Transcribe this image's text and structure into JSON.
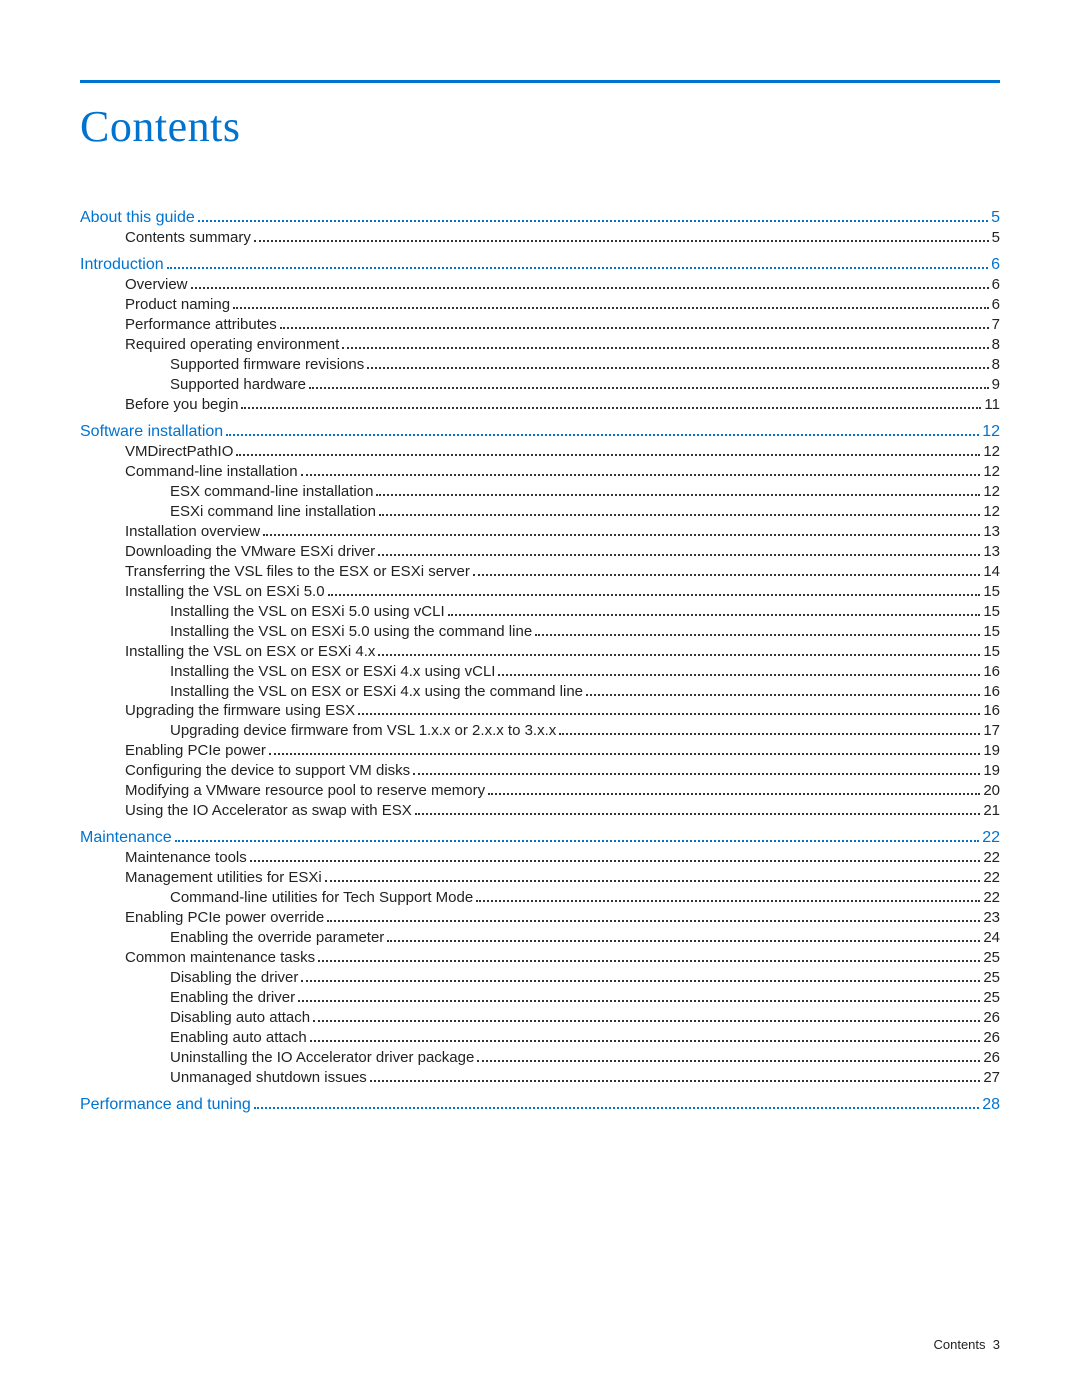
{
  "title": "Contents",
  "footer_label": "Contents",
  "footer_page": "3",
  "entries": [
    {
      "level": 0,
      "label": "About this guide",
      "page": "5"
    },
    {
      "level": 1,
      "label": "Contents summary",
      "page": "5"
    },
    {
      "gap": true
    },
    {
      "level": 0,
      "label": "Introduction",
      "page": "6"
    },
    {
      "level": 1,
      "label": "Overview",
      "page": "6"
    },
    {
      "level": 1,
      "label": "Product naming",
      "page": "6"
    },
    {
      "level": 1,
      "label": "Performance attributes",
      "page": "7"
    },
    {
      "level": 1,
      "label": "Required operating environment",
      "page": "8"
    },
    {
      "level": 2,
      "label": "Supported firmware revisions",
      "page": "8"
    },
    {
      "level": 2,
      "label": "Supported hardware",
      "page": "9"
    },
    {
      "level": 1,
      "label": "Before you begin",
      "page": "11"
    },
    {
      "gap": true
    },
    {
      "level": 0,
      "label": "Software installation",
      "page": "12"
    },
    {
      "level": 1,
      "label": "VMDirectPathIO",
      "page": "12"
    },
    {
      "level": 1,
      "label": "Command-line installation",
      "page": "12"
    },
    {
      "level": 2,
      "label": "ESX command-line installation",
      "page": "12"
    },
    {
      "level": 2,
      "label": "ESXi command line installation",
      "page": "12"
    },
    {
      "level": 1,
      "label": "Installation overview",
      "page": "13"
    },
    {
      "level": 1,
      "label": "Downloading the VMware ESXi driver",
      "page": "13"
    },
    {
      "level": 1,
      "label": "Transferring the VSL files to the ESX or ESXi server",
      "page": "14"
    },
    {
      "level": 1,
      "label": "Installing the VSL on ESXi 5.0",
      "page": "15"
    },
    {
      "level": 2,
      "label": "Installing the VSL on ESXi 5.0 using vCLI",
      "page": "15"
    },
    {
      "level": 2,
      "label": "Installing the VSL on ESXi 5.0 using the command line",
      "page": "15"
    },
    {
      "level": 1,
      "label": "Installing the VSL on ESX or ESXi 4.x",
      "page": "15"
    },
    {
      "level": 2,
      "label": "Installing the VSL on ESX or ESXi 4.x using vCLI",
      "page": "16"
    },
    {
      "level": 2,
      "label": "Installing the VSL on ESX or ESXi 4.x using the command line",
      "page": "16"
    },
    {
      "level": 1,
      "label": "Upgrading the firmware using ESX",
      "page": "16"
    },
    {
      "level": 2,
      "label": "Upgrading device firmware from VSL 1.x.x or 2.x.x to 3.x.x",
      "page": "17"
    },
    {
      "level": 1,
      "label": "Enabling PCIe power",
      "page": "19"
    },
    {
      "level": 1,
      "label": "Configuring the device to support VM disks",
      "page": "19"
    },
    {
      "level": 1,
      "label": "Modifying a VMware resource pool to reserve memory",
      "page": "20"
    },
    {
      "level": 1,
      "label": "Using the IO Accelerator as swap with ESX",
      "page": "21"
    },
    {
      "gap": true
    },
    {
      "level": 0,
      "label": "Maintenance",
      "page": "22"
    },
    {
      "level": 1,
      "label": "Maintenance tools",
      "page": "22"
    },
    {
      "level": 1,
      "label": "Management utilities for ESXi",
      "page": "22"
    },
    {
      "level": 2,
      "label": "Command-line utilities for Tech Support Mode",
      "page": "22"
    },
    {
      "level": 1,
      "label": "Enabling PCIe power override",
      "page": "23"
    },
    {
      "level": 2,
      "label": "Enabling the override parameter",
      "page": "24"
    },
    {
      "level": 1,
      "label": "Common maintenance tasks",
      "page": "25"
    },
    {
      "level": 2,
      "label": "Disabling the driver",
      "page": "25"
    },
    {
      "level": 2,
      "label": "Enabling the driver",
      "page": "25"
    },
    {
      "level": 2,
      "label": "Disabling auto attach",
      "page": "26"
    },
    {
      "level": 2,
      "label": "Enabling auto attach",
      "page": "26"
    },
    {
      "level": 2,
      "label": "Uninstalling the IO Accelerator driver package",
      "page": "26"
    },
    {
      "level": 2,
      "label": "Unmanaged shutdown issues",
      "page": "27"
    },
    {
      "gap": true
    },
    {
      "level": 0,
      "label": "Performance and tuning",
      "page": "28"
    }
  ]
}
